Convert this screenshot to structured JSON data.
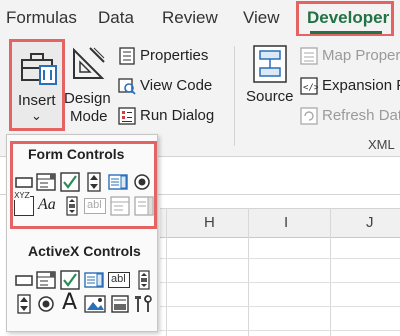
{
  "tabs": [
    {
      "label": "Formulas"
    },
    {
      "label": "Data"
    },
    {
      "label": "Review"
    },
    {
      "label": "View"
    },
    {
      "label": "Developer",
      "active": true
    }
  ],
  "ribbon": {
    "insert": {
      "label": "Insert",
      "chevron": "⌄"
    },
    "design_mode": {
      "line1": "Design",
      "line2": "Mode"
    },
    "properties": "Properties",
    "view_code": "View Code",
    "run_dialog": "Run Dialog",
    "source": "Source",
    "map_properties": "Map Proper",
    "expansion_packs": "Expansion P",
    "refresh_data": "Refresh Dat",
    "xml_group": "XML"
  },
  "dropdown": {
    "form_controls_title": "Form Controls",
    "activex_controls_title": "ActiveX Controls",
    "label_ctrl_text": "Aa",
    "textbox_ctrl_text": "abl",
    "groupbox_ctrl_text": "XYZ",
    "label_A": "A"
  },
  "sheet": {
    "columns": [
      "H",
      "I",
      "J"
    ]
  },
  "colors": {
    "highlight": "#e46464",
    "excel_green": "#217346",
    "icon_blue": "#2a6fb8"
  }
}
